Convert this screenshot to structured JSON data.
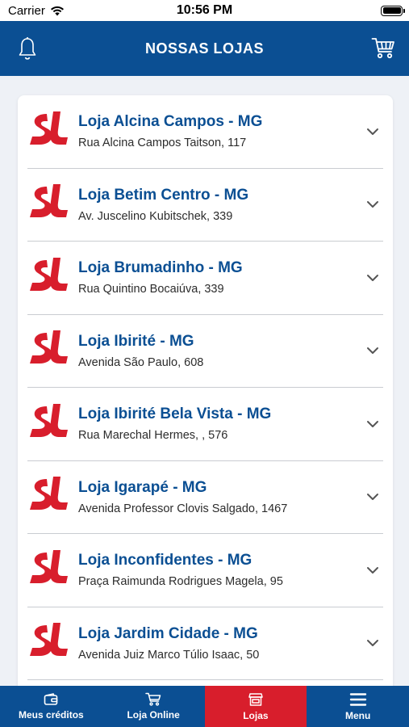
{
  "status_bar": {
    "carrier": "Carrier",
    "time": "10:56 PM"
  },
  "header": {
    "title": "NOSSAS LOJAS",
    "left_icon": "bell-icon",
    "right_icon": "cart-icon"
  },
  "colors": {
    "brand_blue": "#0b4f93",
    "brand_red": "#d81e2c"
  },
  "stores": [
    {
      "name": "Loja Alcina Campos - MG",
      "address": "Rua Alcina Campos Taitson, 117"
    },
    {
      "name": "Loja Betim Centro - MG",
      "address": "Av. Juscelino Kubitschek, 339"
    },
    {
      "name": "Loja Brumadinho - MG",
      "address": "Rua Quintino Bocaiúva, 339"
    },
    {
      "name": "Loja Ibirité - MG",
      "address": "Avenida São Paulo, 608"
    },
    {
      "name": "Loja Ibirité Bela Vista - MG",
      "address": "Rua Marechal Hermes, , 576"
    },
    {
      "name": "Loja Igarapé - MG",
      "address": "Avenida Professor Clovis Salgado, 1467"
    },
    {
      "name": "Loja Inconfidentes - MG",
      "address": "Praça Raimunda Rodrigues Magela, 95"
    },
    {
      "name": "Loja Jardim Cidade - MG",
      "address": "Avenida Juiz Marco Túlio Isaac, 50"
    }
  ],
  "bottom_nav": [
    {
      "label": "Meus créditos",
      "icon": "wallet-icon",
      "active": false
    },
    {
      "label": "Loja Online",
      "icon": "cart-icon",
      "active": false
    },
    {
      "label": "Lojas",
      "icon": "store-icon",
      "active": true
    },
    {
      "label": "Menu",
      "icon": "hamburger-icon",
      "active": false
    }
  ]
}
